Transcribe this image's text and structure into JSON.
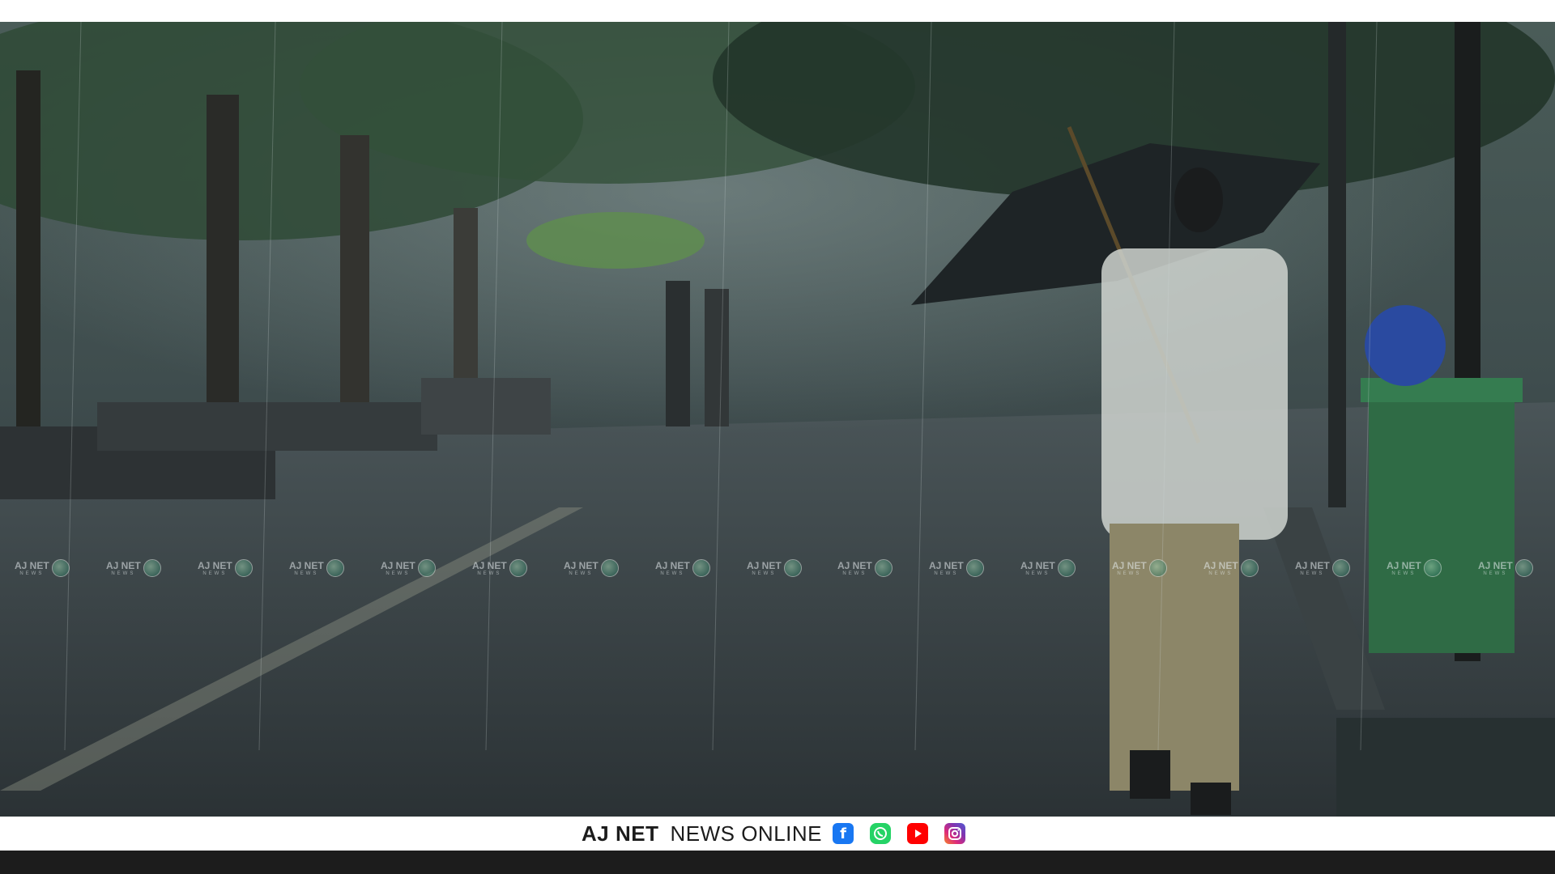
{
  "photo": {
    "subject": "person-with-umbrella-in-rain-icon"
  },
  "watermark": {
    "brand": "AJ NET",
    "sub": "NEWS",
    "repeat_count": 17
  },
  "footer": {
    "brand_bold": "AJ NET",
    "brand_light": "NEWS ONLINE",
    "social": [
      {
        "name": "facebook-icon",
        "color": "#1877f2"
      },
      {
        "name": "whatsapp-icon",
        "color": "#25d366"
      },
      {
        "name": "youtube-icon",
        "color": "#ff0000"
      },
      {
        "name": "instagram-icon",
        "color": "#c13584"
      }
    ]
  },
  "colors": {
    "footer_background": "#ffffff",
    "bottom_strip": "#1c1c1c",
    "text": "#1c1c1c"
  }
}
